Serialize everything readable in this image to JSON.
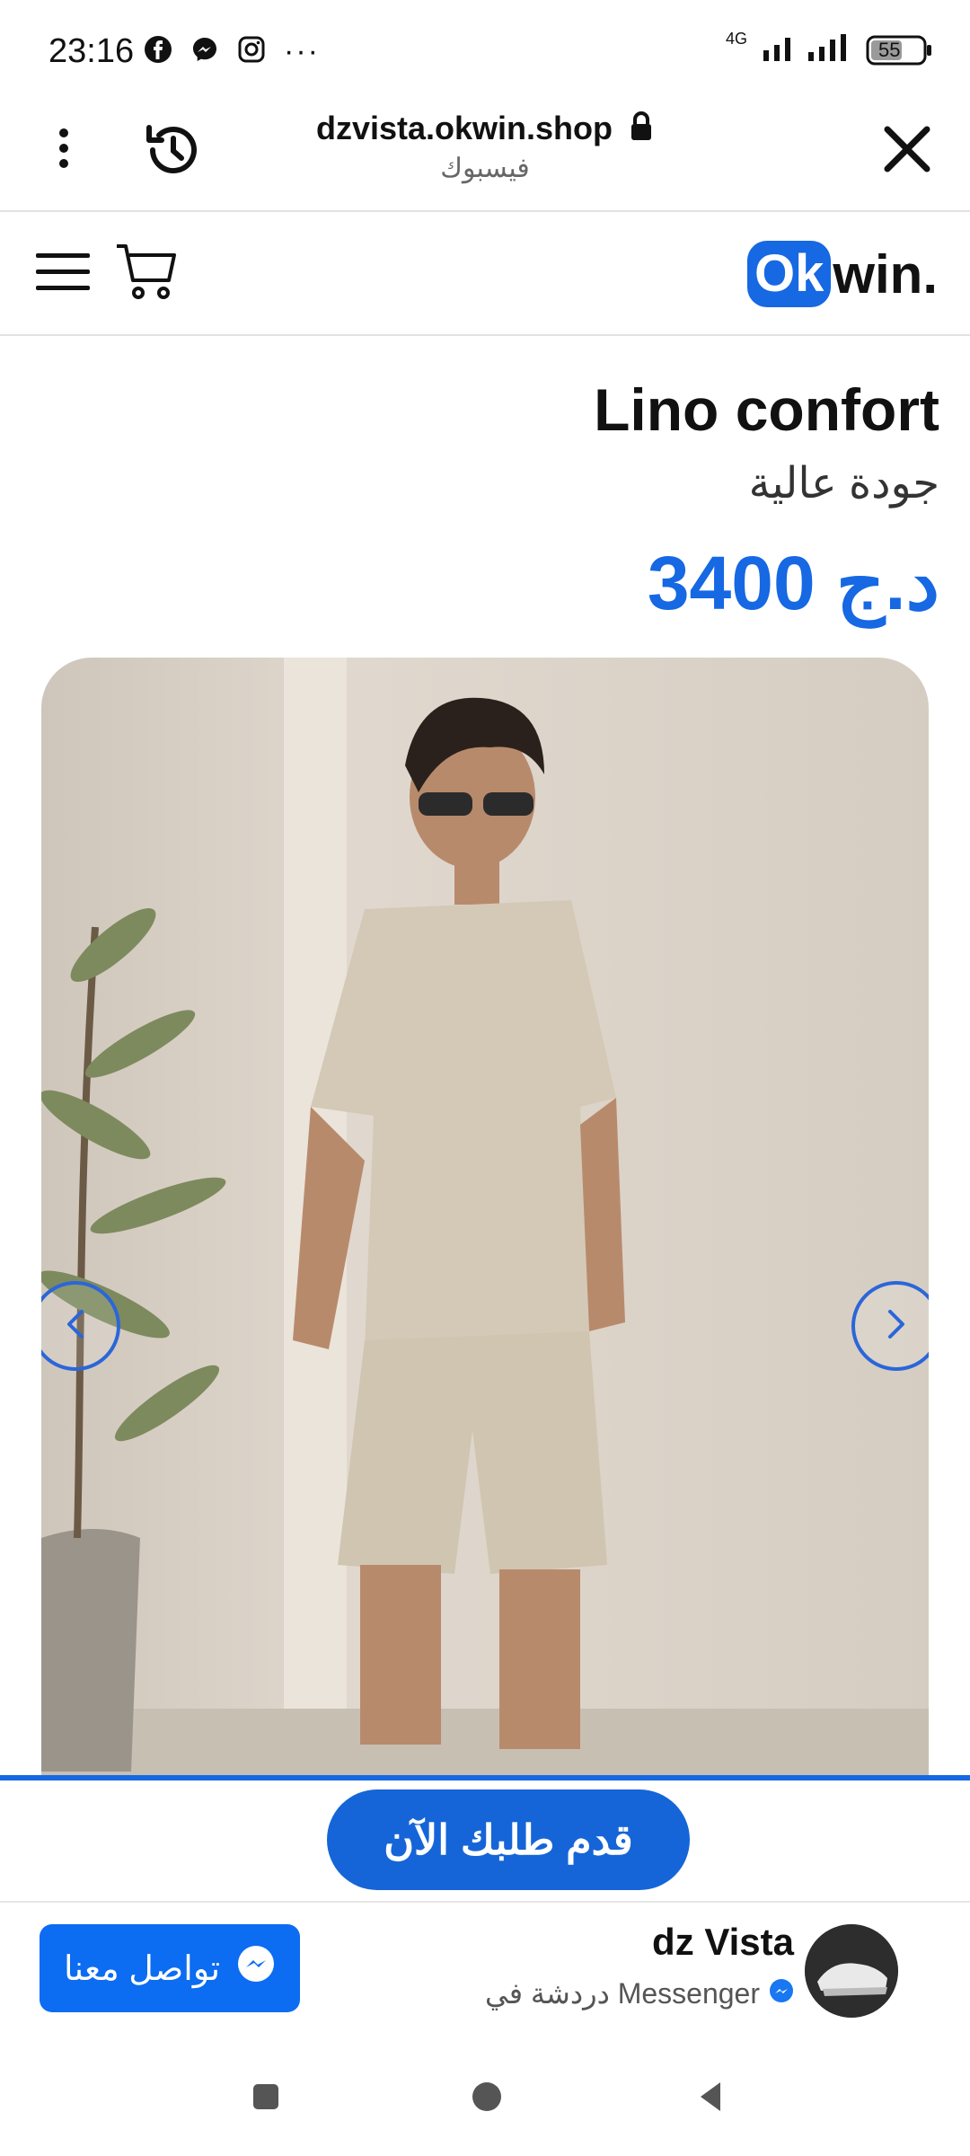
{
  "status_bar": {
    "time": "23:16",
    "network": "4G",
    "battery": "55",
    "more": "···"
  },
  "browser": {
    "host": "dzvista.okwin.shop",
    "subtitle": "فيسبوك"
  },
  "site": {
    "logo_ok": "Ok",
    "logo_win": "win."
  },
  "product": {
    "title": "Lino confort",
    "subtitle": "جودة عالية",
    "price": "3400 د.ج"
  },
  "order": {
    "button_label": "قدم طلبك الآن"
  },
  "messenger": {
    "contact_label": "تواصل معنا",
    "page_name": "dz Vista",
    "status": "دردشة في Messenger"
  },
  "colors": {
    "accent": "#1668e3",
    "messenger_blue": "#0c6cf2"
  },
  "icons": [
    "facebook-icon",
    "messenger-icon",
    "instagram-icon",
    "more-icon",
    "signal-icon",
    "battery-icon",
    "menu-dots-icon",
    "history-icon",
    "lock-icon",
    "close-icon",
    "hamburger-icon",
    "cart-icon",
    "chevron-left-icon",
    "chevron-right-icon",
    "recent-apps-icon",
    "home-icon",
    "back-icon"
  ]
}
